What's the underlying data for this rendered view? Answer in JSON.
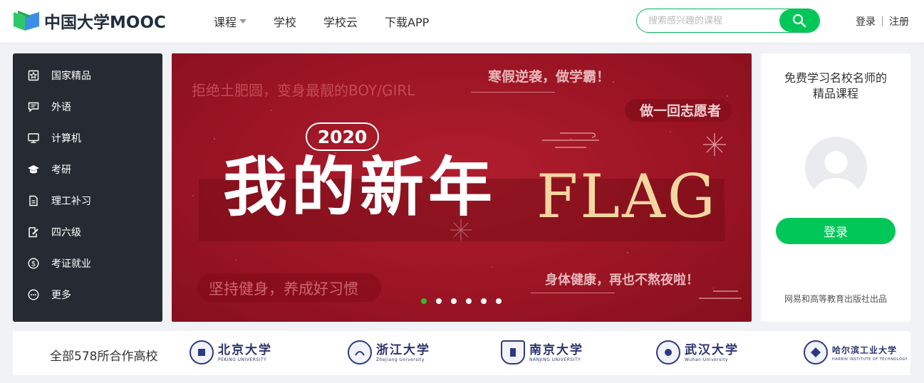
{
  "header": {
    "logo_text": "中国大学MOOC",
    "nav": [
      {
        "label": "课程",
        "has_dropdown": true
      },
      {
        "label": "学校",
        "has_dropdown": false
      },
      {
        "label": "学校云",
        "has_dropdown": false
      },
      {
        "label": "下载APP",
        "has_dropdown": false
      }
    ],
    "search": {
      "placeholder": "搜索感兴趣的课程",
      "value": "",
      "icon": "search-icon"
    },
    "auth": {
      "login": "登录",
      "register": "注册"
    }
  },
  "sidebar": {
    "items": [
      {
        "label": "国家精品",
        "icon": "star-badge-icon"
      },
      {
        "label": "外语",
        "icon": "chat-icon"
      },
      {
        "label": "计算机",
        "icon": "monitor-icon"
      },
      {
        "label": "考研",
        "icon": "graduation-cap-icon"
      },
      {
        "label": "理工补习",
        "icon": "document-icon"
      },
      {
        "label": "四六级",
        "icon": "edit-icon"
      },
      {
        "label": "考证就业",
        "icon": "dollar-coin-icon"
      },
      {
        "label": "更多",
        "icon": "more-dots-icon"
      }
    ]
  },
  "banner": {
    "top_left": "拒绝土肥圆，变身最靓的BOY/GIRL",
    "top_right": "寒假逆袭，做学霸！",
    "volunteer": "做一回志愿者",
    "year": "2020",
    "main": "我的新年",
    "flag": "FLAG",
    "bottom_left": "坚持健身，养成好习惯",
    "bottom_right": "身体健康，再也不熬夜啦！",
    "slide_count": 6,
    "active_slide": 1,
    "colors": {
      "background": "#9a1424",
      "flag_text": "#f3d6a0",
      "active_dot": "#33bb33"
    }
  },
  "login_card": {
    "title_line1": "免费学习名校名师的",
    "title_line2": "精品课程",
    "button": "登录",
    "footer": "网易和高等教育出版社出品"
  },
  "partners": {
    "label": "全部578所合作高校",
    "schools": [
      {
        "cn": "北京大学",
        "en": "PEKING UNIVERSITY"
      },
      {
        "cn": "浙江大学",
        "en": "Zhejiang University"
      },
      {
        "cn": "南京大学",
        "en": "NANJING UNIVERSITY"
      },
      {
        "cn": "武汉大学",
        "en": "Wuhan University"
      },
      {
        "cn": "哈尔滨工业大学",
        "en": "HARBIN INSTITUTE OF TECHNOLOGY"
      }
    ]
  },
  "colors": {
    "brand_green": "#00c758",
    "sidebar_bg": "#262b33",
    "page_bg": "#f0f2f5"
  }
}
